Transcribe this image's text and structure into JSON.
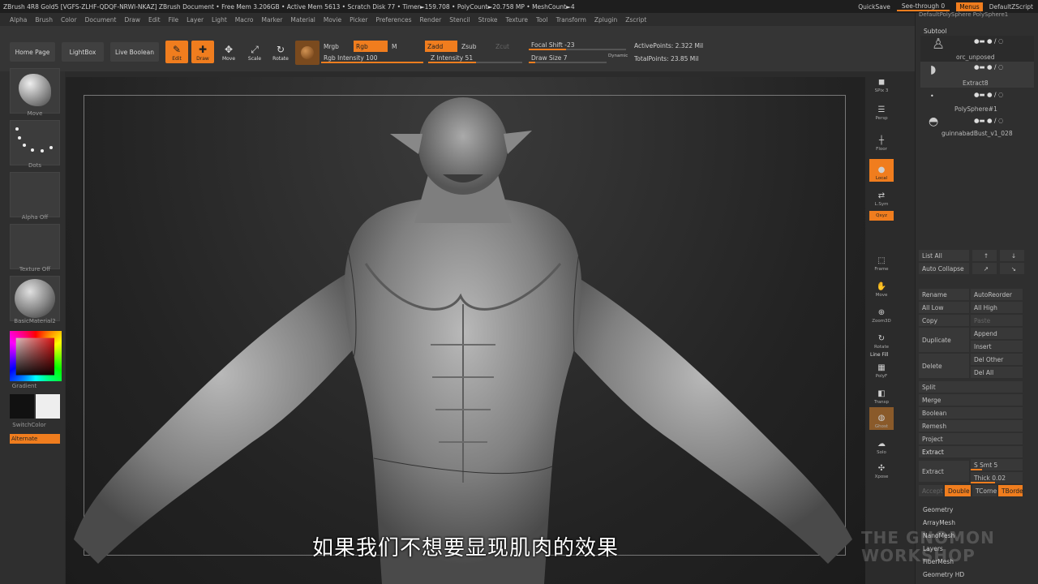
{
  "titlebar": {
    "title": "ZBrush 4R8 Gold5 [VGFS-ZLHF-QDQF-NRWI-NKAZ]   ZBrush Document      • Free Mem 3.206GB • Active Mem 5613 • Scratch Disk 77 • Timer►159.708 • PolyCount►20.758 MP • MeshCount►4",
    "quicksave": "QuickSave",
    "see_through": "See-through  0",
    "menus": "Menus",
    "default_script": "DefaultZScript"
  },
  "menubar": [
    "Alpha",
    "Brush",
    "Color",
    "Document",
    "Draw",
    "Edit",
    "File",
    "Layer",
    "Light",
    "Macro",
    "Marker",
    "Material",
    "Movie",
    "Picker",
    "Preferences",
    "Render",
    "Stencil",
    "Stroke",
    "Texture",
    "Tool",
    "Transform",
    "Zplugin",
    "Zscript"
  ],
  "shelf": {
    "home_page": "Home Page",
    "lightbox": "LightBox",
    "live_boolean": "Live Boolean",
    "tools": [
      {
        "label": "Edit",
        "icon": "edit-icon",
        "active": true
      },
      {
        "label": "Draw",
        "icon": "draw-icon",
        "active": true
      },
      {
        "label": "Move",
        "icon": "move-icon",
        "active": false
      },
      {
        "label": "Scale",
        "icon": "scale-icon",
        "active": false
      },
      {
        "label": "Rotate",
        "icon": "rotate-icon",
        "active": false
      }
    ],
    "mrgb": "Mrgb",
    "rgb": "Rgb",
    "m": "M",
    "rgb_intensity": "Rgb Intensity 100",
    "zadd": "Zadd",
    "zsub": "Zsub",
    "zcut": "Zcut",
    "z_intensity": "Z Intensity 51",
    "focal_shift": "Focal Shift -23",
    "draw_size": "Draw Size 7",
    "dynamic": "Dynamic",
    "active_points": "ActivePoints: 2.322 Mil",
    "total_points": "TotalPoints: 23.85 Mil"
  },
  "left_panel": {
    "move": "Move",
    "dots": "Dots",
    "alpha_off": "Alpha Off",
    "texture_off": "Texture Off",
    "material": "BasicMaterial2",
    "gradient": "Gradient",
    "switch_color": "SwitchColor",
    "alternate": "Alternate"
  },
  "subtitle": "如果我们不想要显现肌肉的效果",
  "right_tools": [
    {
      "label": "SPix 3",
      "icon": "bpr-icon"
    },
    {
      "label": "Persp",
      "icon": "persp-icon"
    },
    {
      "label": "Floor",
      "icon": "floor-icon"
    },
    {
      "label": "Local",
      "icon": "local-icon"
    },
    {
      "label": "L.Sym",
      "icon": "sym-icon"
    },
    {
      "label": "Qxyz",
      "icon": "xyz-icon"
    },
    {
      "label": "Frame",
      "icon": "frame-icon"
    },
    {
      "label": "Move",
      "icon": "hand-icon"
    },
    {
      "label": "Zoom3D",
      "icon": "zoom-icon"
    },
    {
      "label": "Rotate",
      "icon": "rotate-icon"
    },
    {
      "label": "PolyF",
      "icon": "polyf-icon"
    },
    {
      "label": "Transp",
      "icon": "transp-icon"
    },
    {
      "label": "Ghost",
      "icon": "ghost-icon"
    },
    {
      "label": "Solo",
      "icon": "solo-icon"
    },
    {
      "label": "Xpose",
      "icon": "xpose-icon"
    }
  ],
  "dynamic_label": "Dynamic",
  "line_fill": "Line Fill",
  "tray": {
    "top_tabs": "DefaultPolySphere   PolySphere1",
    "subtool_header": "Subtool",
    "subtools": [
      "orc_unposed",
      "Extract8",
      "PolySphere#1",
      "guinnabadBust_v1_028"
    ],
    "list_all": "List All",
    "auto_collapse": "Auto Collapse",
    "rename": "Rename",
    "auto_reorder": "AutoReorder",
    "all_low": "All Low",
    "all_high": "All High",
    "copy": "Copy",
    "paste": "Paste",
    "duplicate": "Duplicate",
    "append": "Append",
    "insert": "Insert",
    "delete": "Delete",
    "del_other": "Del Other",
    "del_all": "Del All",
    "split": "Split",
    "merge": "Merge",
    "boolean": "Boolean",
    "remesh": "Remesh",
    "project": "Project",
    "extract_header": "Extract",
    "extract": "Extract",
    "s_smt": "S Smt 5",
    "thick": "Thick 0.02",
    "accept": "Accept",
    "double": "Double",
    "tcorne": "TCorne",
    "tborde": "TBorde",
    "sections": [
      "Geometry",
      "ArrayMesh",
      "NanoMesh",
      "Layers",
      "FiberMesh",
      "Geometry HD"
    ]
  },
  "watermark": "THE GNOMON WORKSHOP",
  "colors": {
    "accent": "#f07d1e",
    "bg": "#2b2b2b"
  }
}
